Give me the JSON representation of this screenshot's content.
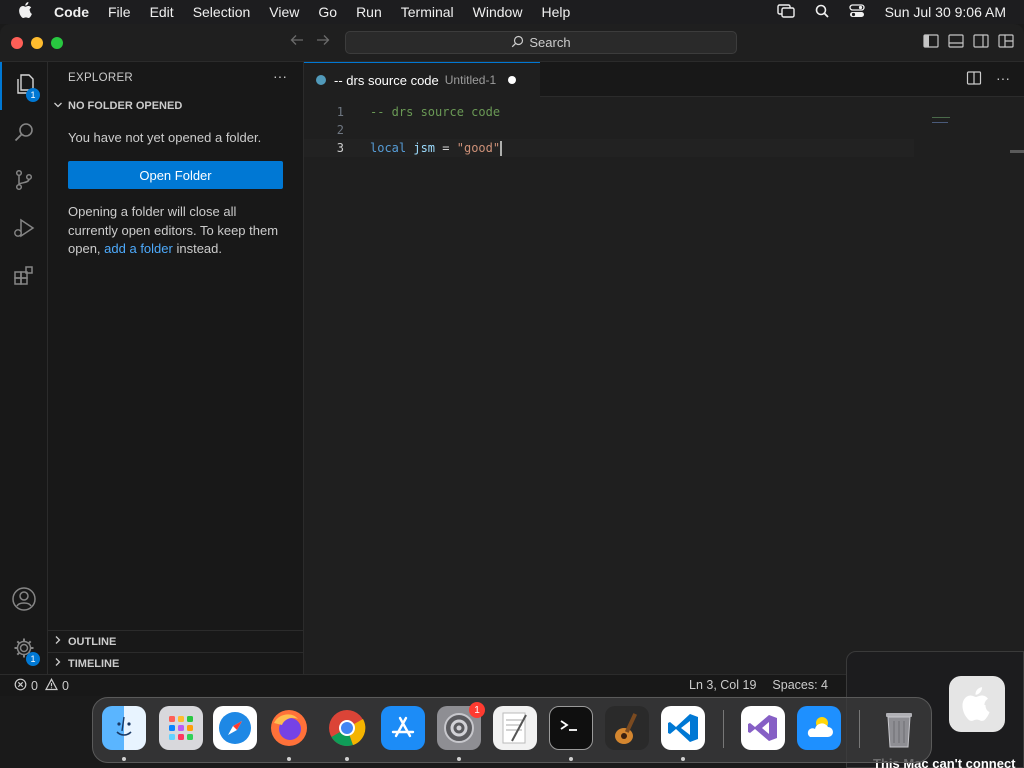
{
  "menubar": {
    "app_name": "Code",
    "items": [
      "File",
      "Edit",
      "Selection",
      "View",
      "Go",
      "Run",
      "Terminal",
      "Window",
      "Help"
    ],
    "datetime": "Sun Jul 30  9:06 AM"
  },
  "titlebar": {
    "search_label": "Search"
  },
  "activitybar": {
    "explorer_badge": "1",
    "settings_badge": "1"
  },
  "sidebar": {
    "title": "EXPLORER",
    "more": "···",
    "section_no_folder": "NO FOLDER OPENED",
    "no_folder_message": "You have not yet opened a folder.",
    "open_folder_button": "Open Folder",
    "desc_part1": "Opening a folder will close all currently open editors. To keep them open,",
    "desc_link": "add a folder",
    "desc_part2": "instead.",
    "section_outline": "OUTLINE",
    "section_timeline": "TIMELINE"
  },
  "editor": {
    "tab_title": "-- drs source code",
    "tab_description": "Untitled-1",
    "lines": [
      {
        "number": "1",
        "comment": "-- drs source code"
      },
      {
        "number": "2"
      },
      {
        "number": "3",
        "keyword": "local",
        "variable": "jsm",
        "operator": "=",
        "string": "\"good\""
      }
    ]
  },
  "statusbar": {
    "errors": "0",
    "warnings": "0",
    "cursor_position": "Ln 3, Col 19",
    "indentation": "Spaces: 4"
  },
  "dock": {
    "settings_badge": "1"
  },
  "notification": {
    "text": "This Mac can't connect"
  }
}
